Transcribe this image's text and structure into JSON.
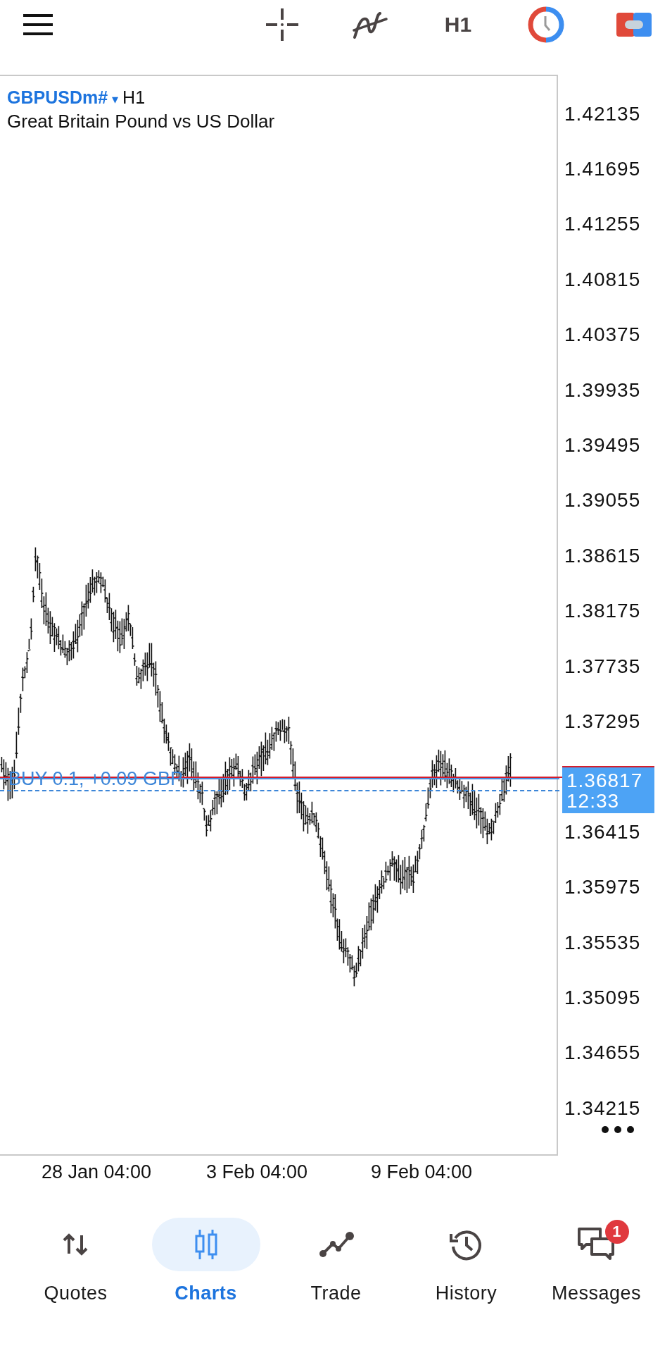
{
  "toolbar": {
    "timeframe": "H1"
  },
  "chart": {
    "symbol": "GBPUSDm#",
    "symbol_dropdown": "▾",
    "timeframe": "H1",
    "description": "Great Britain Pound vs US Dollar",
    "position_label": "BUY 0.1,  +0.09 GBP",
    "current_price": "1.36817",
    "bar_countdown": "12:33",
    "price_axis": [
      "1.42135",
      "1.41695",
      "1.41255",
      "1.40815",
      "1.40375",
      "1.39935",
      "1.39495",
      "1.39055",
      "1.38615",
      "1.38175",
      "1.37735",
      "1.37295",
      "1.36415",
      "1.35975",
      "1.35535",
      "1.35095",
      "1.34655",
      "1.34215"
    ],
    "time_axis": [
      "28 Jan 04:00",
      "3 Feb 04:00",
      "9 Feb 04:00"
    ]
  },
  "bottom_nav": [
    {
      "label": "Quotes",
      "selected": false
    },
    {
      "label": "Charts",
      "selected": true
    },
    {
      "label": "Trade",
      "selected": false
    },
    {
      "label": "History",
      "selected": false
    },
    {
      "label": "Messages",
      "selected": false,
      "badge": "1"
    }
  ]
}
